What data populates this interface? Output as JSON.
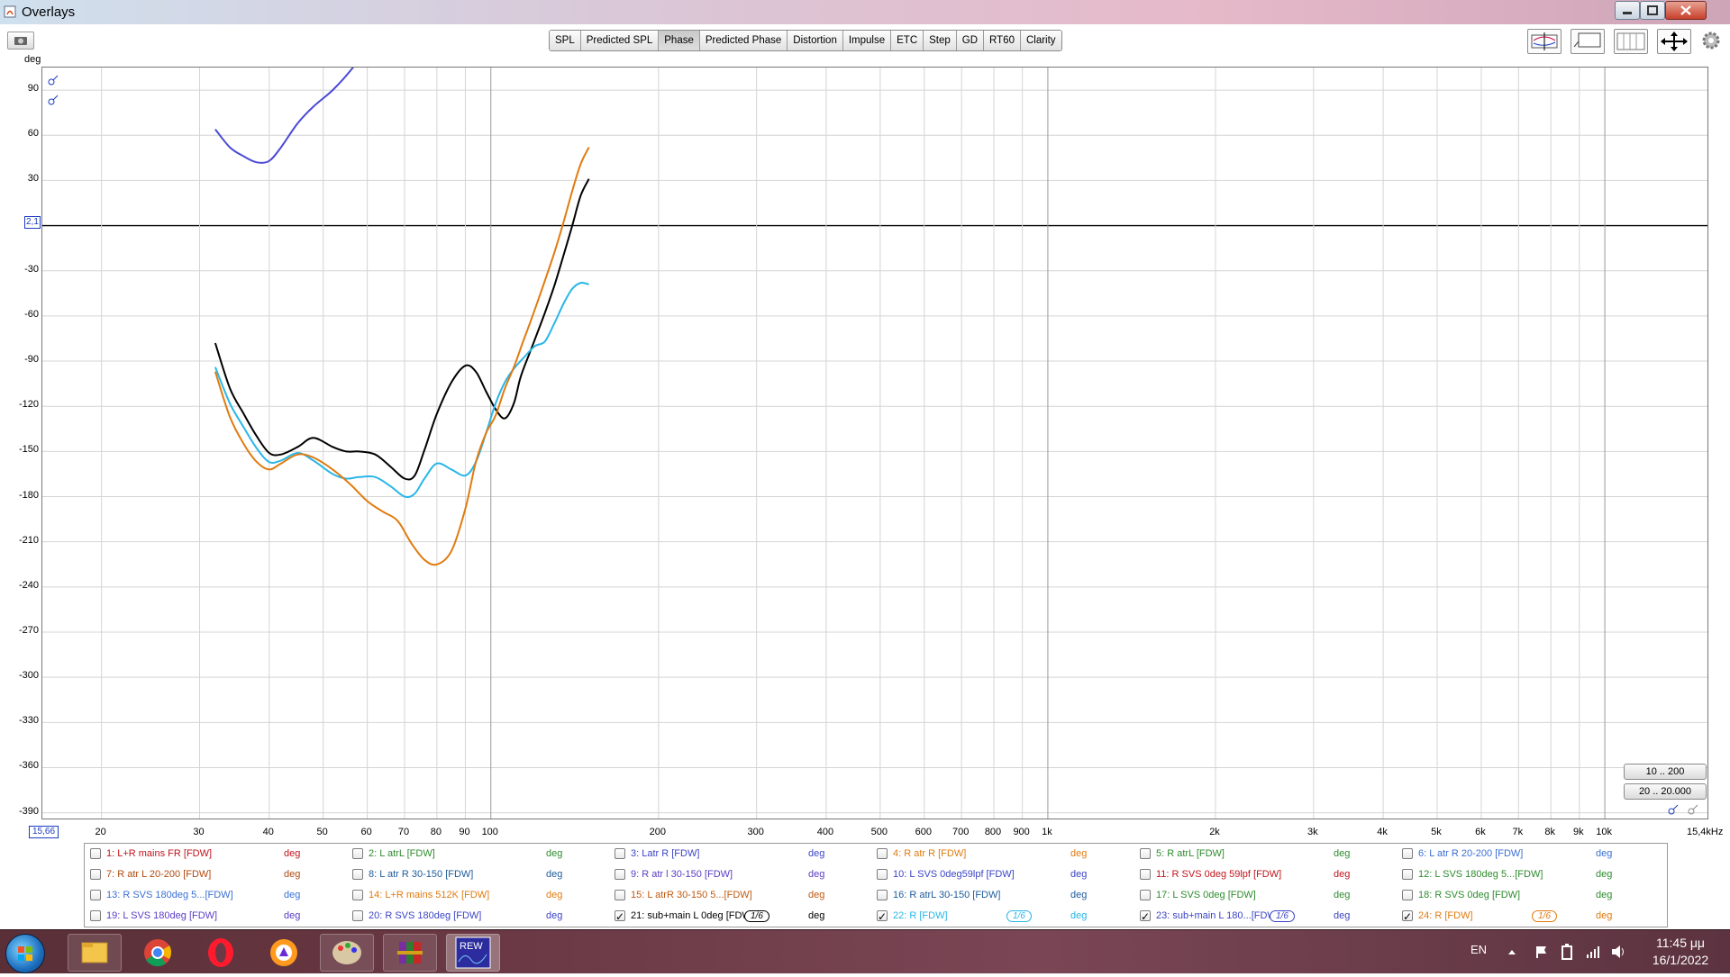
{
  "window": {
    "title": "Overlays"
  },
  "tabs": [
    "SPL",
    "Predicted SPL",
    "Phase",
    "Predicted Phase",
    "Distortion",
    "Impulse",
    "ETC",
    "Step",
    "GD",
    "RT60",
    "Clarity"
  ],
  "active_tab": "Phase",
  "y_axis": {
    "unit": "deg",
    "ticks": [
      "90",
      "60",
      "30",
      "0",
      "-30",
      "-60",
      "-90",
      "-120",
      "-150",
      "-180",
      "-210",
      "-240",
      "-270",
      "-300",
      "-330",
      "-360",
      "-390"
    ],
    "cursor_value": "2,1"
  },
  "x_axis": {
    "ticks": [
      "20",
      "30",
      "40",
      "50",
      "60",
      "70",
      "80",
      "90",
      "100",
      "200",
      "300",
      "400",
      "500",
      "600",
      "700",
      "800",
      "900",
      "1k",
      "2k",
      "3k",
      "4k",
      "5k",
      "6k",
      "7k",
      "8k",
      "9k",
      "10k"
    ],
    "start_value": "15,66",
    "end_label": "15,4kHz"
  },
  "range_buttons": [
    "10 .. 200",
    "20 .. 20.000"
  ],
  "legend": [
    [
      {
        "label": "1: L+R mains FR [FDW]",
        "unit": "deg",
        "color": "#c0141c",
        "checked": false
      },
      {
        "label": "2: L atrL [FDW]",
        "unit": "deg",
        "color": "#2e8b2e",
        "checked": false
      },
      {
        "label": "3: Latr R [FDW]",
        "unit": "deg",
        "color": "#3b44c6",
        "checked": false
      },
      {
        "label": "4: R atr R [FDW]",
        "unit": "deg",
        "color": "#e07b10",
        "checked": false
      },
      {
        "label": "5: R atrL [FDW]",
        "unit": "deg",
        "color": "#2e8b2e",
        "checked": false
      },
      {
        "label": "6: L atr R 20-200 [FDW]",
        "unit": "deg",
        "color": "#3a6fd6",
        "checked": false
      }
    ],
    [
      {
        "label": "7: R atr L 20-200 [FDW]",
        "unit": "deg",
        "color": "#b04a10",
        "checked": false
      },
      {
        "label": "8: L atr R 30-150 [FDW]",
        "unit": "deg",
        "color": "#1e5c9a",
        "checked": false
      },
      {
        "label": "9: R atr l 30-150 [FDW]",
        "unit": "deg",
        "color": "#5a3cc6",
        "checked": false
      },
      {
        "label": "10: L SVS 0deg59lpf [FDW]",
        "unit": "deg",
        "color": "#3b44c6",
        "checked": false
      },
      {
        "label": "11: R SVS 0deg 59lpf [FDW]",
        "unit": "deg",
        "color": "#c0141c",
        "checked": false
      },
      {
        "label": "12: L SVS 180deg 5...[FDW]",
        "unit": "deg",
        "color": "#2e8b2e",
        "checked": false
      }
    ],
    [
      {
        "label": "13: R SVS 180deg 5...[FDW]",
        "unit": "deg",
        "color": "#3a6fd6",
        "checked": false
      },
      {
        "label": "14: L+R mains 512K [FDW]",
        "unit": "deg",
        "color": "#e07b10",
        "checked": false
      },
      {
        "label": "15: L atrR 30-150 5...[FDW]",
        "unit": "deg",
        "color": "#c05a10",
        "checked": false
      },
      {
        "label": "16: R atrL 30-150 [FDW]",
        "unit": "deg",
        "color": "#1e5c9a",
        "checked": false
      },
      {
        "label": "17: L SVS 0deg [FDW]",
        "unit": "deg",
        "color": "#2e8b2e",
        "checked": false
      },
      {
        "label": "18: R SVS 0deg [FDW]",
        "unit": "deg",
        "color": "#2e8b2e",
        "checked": false
      }
    ],
    [
      {
        "label": "19: L SVS 180deg [FDW]",
        "unit": "deg",
        "color": "#5a3cc6",
        "checked": false
      },
      {
        "label": "20: R SVS 180deg [FDW]",
        "unit": "deg",
        "color": "#3b44c6",
        "checked": false
      },
      {
        "label": "21: sub+main  L 0deg [FDW",
        "unit": "deg",
        "color": "#000000",
        "checked": true,
        "smoothing": "1/6"
      },
      {
        "label": "22: R [FDW]",
        "unit": "deg",
        "color": "#29b6e8",
        "checked": true,
        "smoothing": "1/6"
      },
      {
        "label": "23: sub+main L 180...[FDW",
        "unit": "deg",
        "color": "#3b44c6",
        "checked": true,
        "smoothing": "1/6"
      },
      {
        "label": "24: R [FDW]",
        "unit": "deg",
        "color": "#e07b10",
        "checked": true,
        "smoothing": "1/6"
      }
    ]
  ],
  "chart_data": {
    "type": "line",
    "x_scale": "log",
    "xlim": [
      15.66,
      15400
    ],
    "ylim": [
      -395,
      105
    ],
    "ylabel": "deg",
    "series": [
      {
        "name": "23: sub+main L 180...[FDW",
        "color": "#4a4ad6",
        "x": [
          32,
          34,
          36,
          38,
          40,
          42,
          45,
          48,
          52,
          56,
          60
        ],
        "y": [
          64,
          52,
          46,
          42,
          43,
          52,
          68,
          79,
          90,
          103,
          118
        ]
      },
      {
        "name": "21: sub+main  L 0deg [FDW",
        "color": "#000000",
        "x": [
          32,
          34,
          36,
          38,
          40,
          42,
          45,
          48,
          52,
          55,
          58,
          62,
          66,
          70,
          73,
          76,
          80,
          85,
          90,
          94,
          98,
          102,
          106,
          110,
          113,
          117,
          121,
          125,
          130,
          135,
          140,
          145,
          150
        ],
        "y": [
          -78,
          -108,
          -125,
          -140,
          -151,
          -152,
          -147,
          -141,
          -147,
          -150,
          -150,
          -152,
          -160,
          -168,
          -166,
          -149,
          -125,
          -104,
          -93,
          -97,
          -110,
          -122,
          -128,
          -118,
          -101,
          -86,
          -72,
          -58,
          -40,
          -20,
          0,
          20,
          31
        ]
      },
      {
        "name": "22: R [FDW]",
        "color": "#29b6e8",
        "x": [
          32,
          34,
          36,
          38,
          40,
          42,
          45,
          48,
          52,
          55,
          58,
          62,
          66,
          70,
          73,
          76,
          80,
          85,
          90,
          94,
          98,
          102,
          106,
          110,
          115,
          120,
          125,
          130,
          135,
          140,
          145,
          150
        ],
        "y": [
          -94,
          -118,
          -134,
          -148,
          -157,
          -156,
          -151,
          -156,
          -165,
          -168,
          -167,
          -167,
          -173,
          -180,
          -178,
          -168,
          -158,
          -162,
          -166,
          -157,
          -138,
          -118,
          -104,
          -95,
          -87,
          -80,
          -77,
          -65,
          -52,
          -42,
          -38,
          -39
        ]
      },
      {
        "name": "24: R [FDW]",
        "color": "#e07b10",
        "x": [
          32,
          34,
          36,
          38,
          40,
          42,
          45,
          48,
          52,
          56,
          60,
          64,
          68,
          72,
          76,
          80,
          85,
          90,
          94,
          98,
          102,
          106,
          110,
          114,
          118,
          122,
          126,
          130,
          135,
          140,
          145,
          150
        ],
        "y": [
          -97,
          -127,
          -145,
          -157,
          -162,
          -158,
          -152,
          -154,
          -162,
          -172,
          -183,
          -190,
          -196,
          -211,
          -222,
          -225,
          -216,
          -188,
          -157,
          -138,
          -126,
          -108,
          -94,
          -78,
          -63,
          -48,
          -33,
          -18,
          2,
          23,
          41,
          52
        ]
      }
    ]
  }
}
